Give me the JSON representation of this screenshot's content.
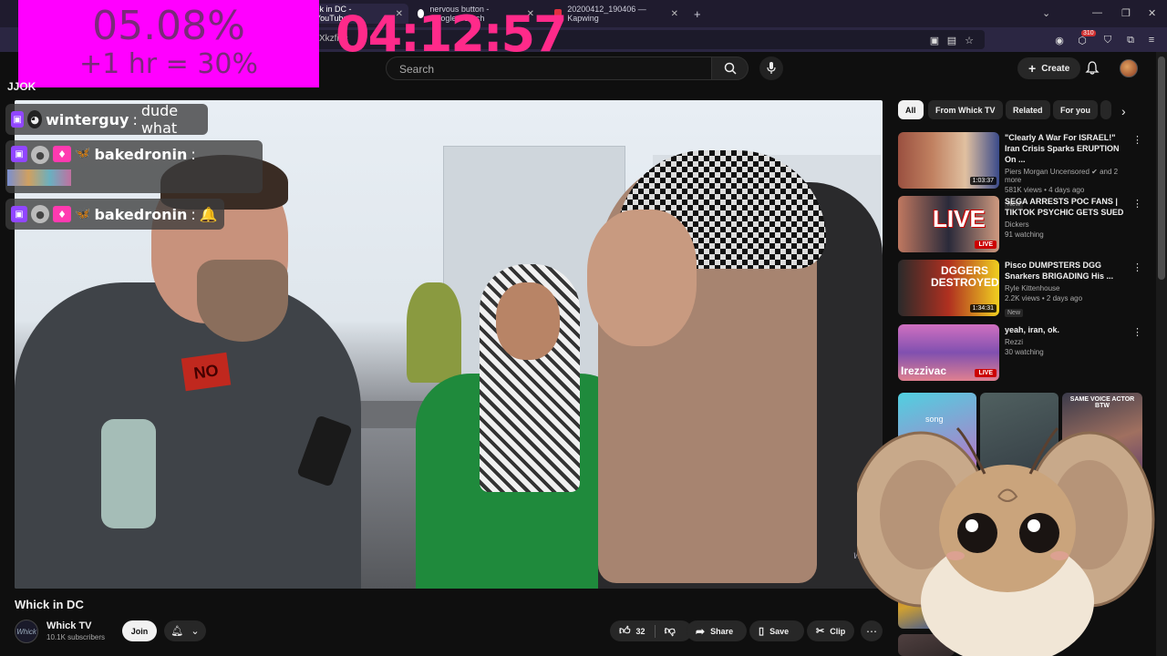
{
  "browser": {
    "tabs": [
      {
        "label": "ck in DC - YouTube",
        "active": true
      },
      {
        "label": "nervous button - Google Search",
        "active": false
      },
      {
        "label": "20200412_190406 — Kapwing",
        "active": false
      }
    ],
    "new_tab": "+",
    "url_fragment": "Xkzfi  lc",
    "extension_badge": "310"
  },
  "overlays": {
    "percent_line1": "05.08%",
    "percent_line2": "+1 hr = 30%",
    "timer": "04:12:57",
    "hidden_text": "JJOK"
  },
  "chat": [
    {
      "user": "winterguy",
      "message": "dude what"
    },
    {
      "user": "bakedronin",
      "message": ""
    },
    {
      "user": "bakedronin",
      "message": "🔔"
    }
  ],
  "header": {
    "search_placeholder": "Search",
    "create_label": "Create"
  },
  "video": {
    "title": "Whick in DC",
    "sign_text": "NO",
    "channel": {
      "name": "Whick TV",
      "subscribers": "10.1K subscribers",
      "avatar_text": "Whick"
    },
    "join_label": "Join",
    "likes": "32",
    "share_label": "Share",
    "save_label": "Save",
    "clip_label": "Clip",
    "watermark": "Whick"
  },
  "sidebar": {
    "chips": [
      "All",
      "From Whick TV",
      "Related",
      "For you"
    ],
    "recommendations": [
      {
        "title": "\"Clearly A War For ISRAEL!\" Iran Crisis Sparks ERUPTION On ...",
        "channel": "Piers Morgan Uncensored",
        "meta": "581K views • 4 days ago",
        "badge": "New",
        "duration": "1:03:37",
        "live": false
      },
      {
        "title": "SEGA ARRESTS POC FANS | TIKTOK PSYCHIC GETS SUED",
        "channel": "Dickers",
        "meta": "91 watching",
        "badge": "",
        "duration": "",
        "live": true,
        "thumb_text": "LIVE"
      },
      {
        "title": "Pisco DUMPSTERS DGG Snarkers BRIGADING His ...",
        "channel": "Ryle Kittenhouse",
        "meta": "2.2K views • 2 days ago",
        "badge": "New",
        "duration": "1:34:31",
        "live": false,
        "thumb_text": "DGGERS DESTROYED"
      },
      {
        "title": "yeah, iran, ok.",
        "channel": "Rezzi",
        "meta": "30 watching",
        "badge": "",
        "duration": "",
        "live": true,
        "thumb_text": "Irezzivac"
      }
    ],
    "and_more": "and 2 more",
    "live_label": "LIVE",
    "shorts_labels": [
      "song",
      "SAME VOICE ACTOR BTW"
    ]
  },
  "colors": {
    "overlay_magenta": "#ff00ff",
    "timer_pink": "#ff2a8a",
    "twitch_purple": "#9146ff",
    "live_red": "#cc0000",
    "background": "#0f0f0f"
  }
}
